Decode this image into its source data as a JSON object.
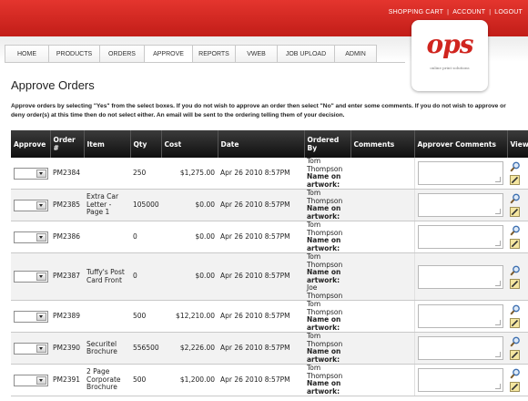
{
  "header": {
    "links": [
      "SHOPPING CART",
      "ACCOUNT",
      "LOGOUT"
    ],
    "separator": "|",
    "logo": {
      "mark": "ops",
      "tagline": "online print solutions"
    }
  },
  "nav": {
    "tabs": [
      {
        "label": "HOME",
        "active": false
      },
      {
        "label": "PRODUCTS",
        "active": false
      },
      {
        "label": "ORDERS",
        "active": false
      },
      {
        "label": "APPROVE",
        "active": true
      },
      {
        "label": "REPORTS",
        "active": false
      },
      {
        "label": "VWEB",
        "active": false
      },
      {
        "label": "JOB UPLOAD",
        "active": false
      },
      {
        "label": "ADMIN",
        "active": false
      }
    ]
  },
  "page": {
    "title": "Approve Orders",
    "instructions": "Approve orders by selecting \"Yes\" from the select boxes. If you do not wish to approve an order then select \"No\" and enter some comments. If you do not wish to approve or deny order(s) at this time then do not select either. An email will be sent to the ordering telling them of your decision."
  },
  "table": {
    "headers": [
      "Approve",
      "Order #",
      "Item",
      "Qty",
      "Cost",
      "Date",
      "Ordered By",
      "Comments",
      "Approver Comments",
      "View"
    ],
    "name_label": "Name on artwork:",
    "rows": [
      {
        "order": "PM2384",
        "item": "",
        "qty": "250",
        "cost": "$1,275.00",
        "date": "Apr 26 2010 8:57PM",
        "ordered_by": "Tom Thompson",
        "artwork_name": "",
        "comments": "",
        "approve": ""
      },
      {
        "order": "PM2385",
        "item": "Extra Car Letter - Page 1",
        "qty": "105000",
        "cost": "$0.00",
        "date": "Apr 26 2010 8:57PM",
        "ordered_by": "Tom Thompson",
        "artwork_name": "",
        "comments": "",
        "approve": ""
      },
      {
        "order": "PM2386",
        "item": "",
        "qty": "0",
        "cost": "$0.00",
        "date": "Apr 26 2010 8:57PM",
        "ordered_by": "Tom Thompson",
        "artwork_name": "",
        "comments": "",
        "approve": ""
      },
      {
        "order": "PM2387",
        "item": "Tuffy's Post Card Front",
        "qty": "0",
        "cost": "$0.00",
        "date": "Apr 26 2010 8:57PM",
        "ordered_by": "Tom Thompson",
        "artwork_name": "Joe Thompson",
        "comments": "",
        "approve": ""
      },
      {
        "order": "PM2389",
        "item": "",
        "qty": "500",
        "cost": "$12,210.00",
        "date": "Apr 26 2010 8:57PM",
        "ordered_by": "Tom Thompson",
        "artwork_name": "",
        "comments": "",
        "approve": ""
      },
      {
        "order": "PM2390",
        "item": "Securitel Brochure",
        "qty": "556500",
        "cost": "$2,226.00",
        "date": "Apr 26 2010 8:57PM",
        "ordered_by": "Tom Thompson",
        "artwork_name": "",
        "comments": "",
        "approve": ""
      },
      {
        "order": "PM2391",
        "item": "2 Page Corporate Brochure",
        "qty": "500",
        "cost": "$1,200.00",
        "date": "Apr 26 2010 8:57PM",
        "ordered_by": "Tom Thompson",
        "artwork_name": "",
        "comments": "",
        "approve": ""
      }
    ]
  },
  "icons": {
    "view": "magnifier-icon",
    "edit": "edit-pencil-icon",
    "dropdown": "chevron-down-icon"
  },
  "colors": {
    "brand_red": "#d0251f",
    "header_dark": "#1a1a1a",
    "link_blue": "#1a4fa0"
  }
}
